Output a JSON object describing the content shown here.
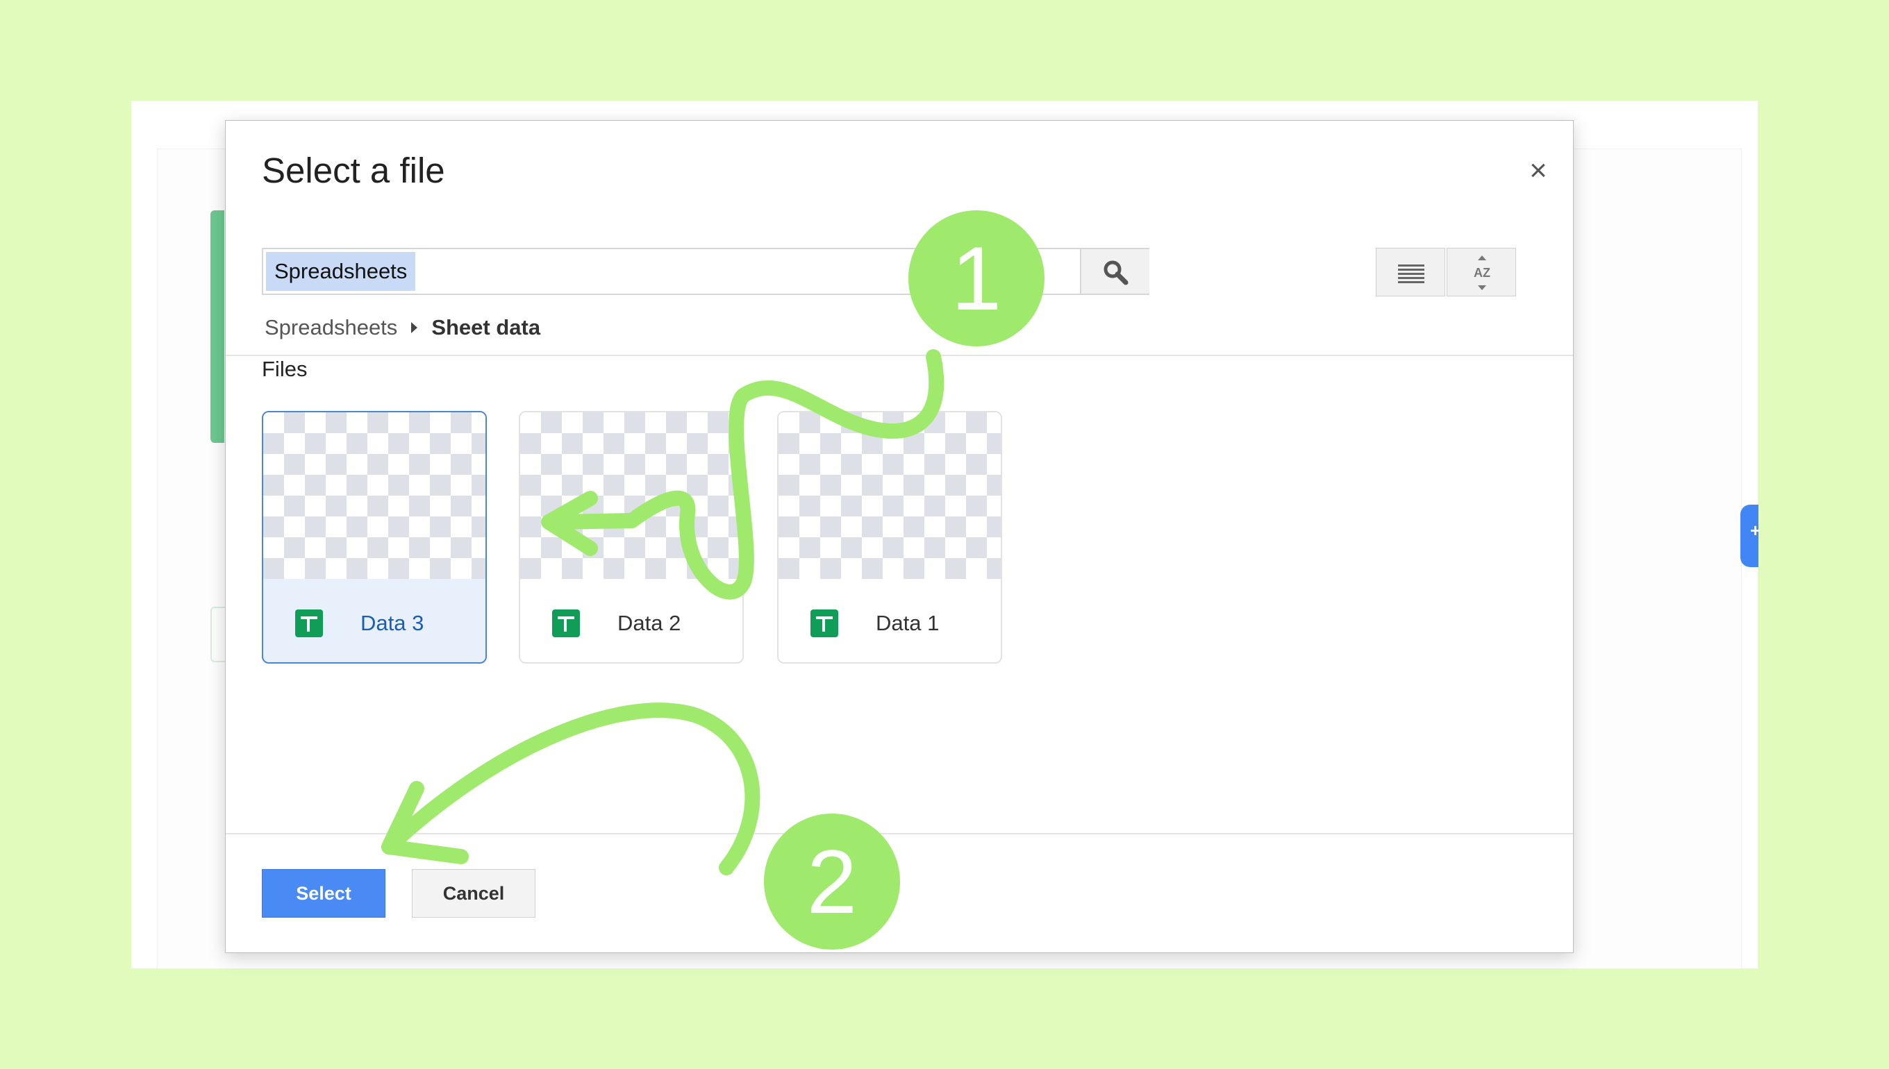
{
  "dialog": {
    "title": "Select a file",
    "close_label": "×"
  },
  "search": {
    "chip_label": "Spreadsheets"
  },
  "breadcrumb": {
    "items": [
      "Spreadsheets",
      "Sheet data"
    ]
  },
  "section_label": "Files",
  "files": [
    {
      "name": "Data 3",
      "selected": true,
      "icon": "sheets-icon"
    },
    {
      "name": "Data 2",
      "selected": false,
      "icon": "sheets-icon"
    },
    {
      "name": "Data 1",
      "selected": false,
      "icon": "sheets-icon"
    }
  ],
  "buttons": {
    "select_label": "Select",
    "cancel_label": "Cancel"
  },
  "annotations": {
    "step1": "1",
    "step2": "2"
  },
  "toolbar": {
    "list_view_icon": "list-view-icon",
    "sort_icon": "sort-az-icon",
    "sort_label": "AZ"
  },
  "colors": {
    "background": "#e1fbbd",
    "accent": "#4a8af4",
    "annotation": "#9fea6c",
    "sheets_green": "#0f9d58"
  }
}
